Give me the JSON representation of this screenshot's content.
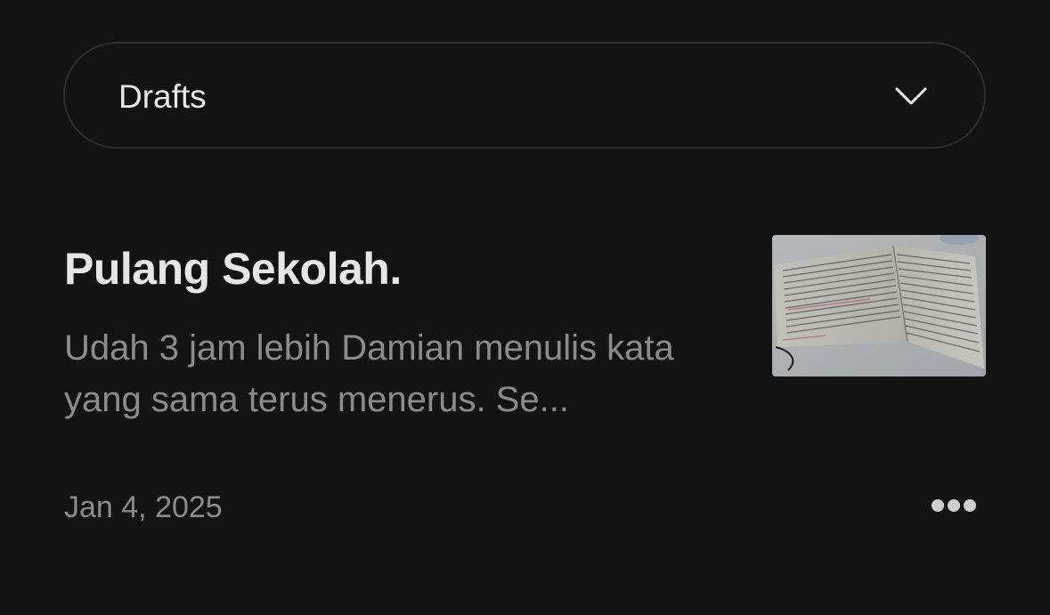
{
  "filter": {
    "selected_label": "Drafts",
    "icon": "chevron-down-icon"
  },
  "story": {
    "title": "Pulang Sekolah.",
    "excerpt": "Udah 3 jam lebih Damian menulis kata yang sama terus menerus. Se...",
    "date": "Jan 4, 2025",
    "thumbnail_subject": "open notebook with handwritten text",
    "more_icon": "more-horizontal-icon"
  },
  "colors": {
    "background": "#131313",
    "border": "#2f2f2f",
    "text_primary": "#e6e6e6",
    "text_secondary": "#8c8c8c"
  }
}
